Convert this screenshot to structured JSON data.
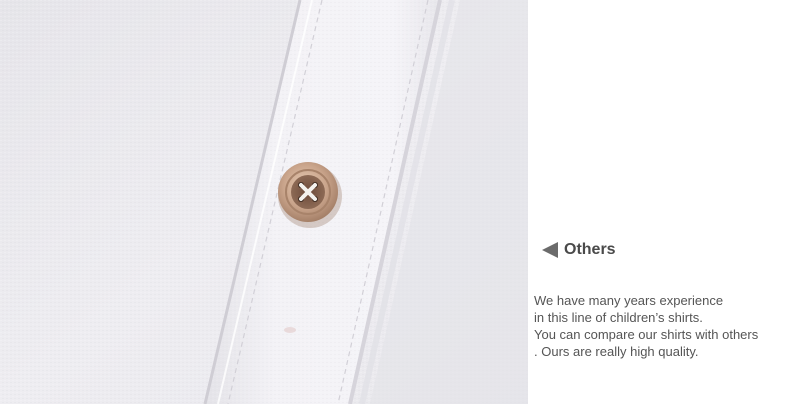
{
  "section": {
    "heading": "Others",
    "icon": "left-triangle-icon",
    "description_lines": [
      "We have many years experience",
      "in this line of children’s shirts.",
      "You can compare our shirts with others",
      ". Ours are really high quality."
    ]
  },
  "colors": {
    "fabric": "#ecebef",
    "placket": "#f1f0f4",
    "button": "#c9a48b",
    "heading_text": "#4a4a4a",
    "body_text": "#555555"
  }
}
